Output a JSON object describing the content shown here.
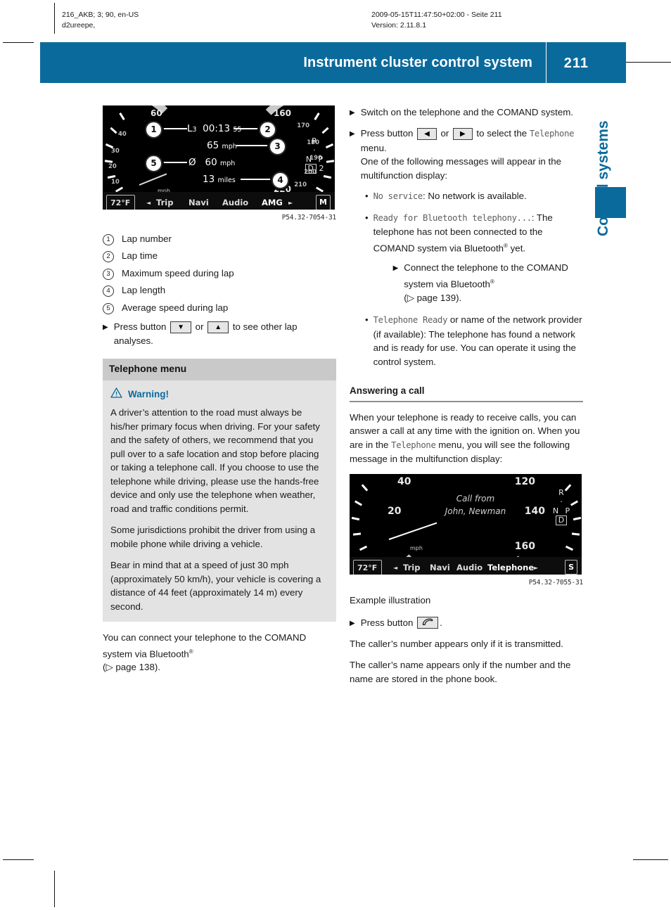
{
  "print_header": {
    "left_line1": "216_AKB; 3; 90, en-US",
    "left_line2": "d2ureepe,",
    "mid_line1": "2009-05-15T11:47:50+02:00 - Seite 211",
    "mid_line2": "Version: 2.11.8.1"
  },
  "banner": {
    "title": "Instrument cluster control system",
    "page_number": "211",
    "color": "#0b6a9c"
  },
  "side_tab": {
    "label": "Control systems"
  },
  "figure_lap": {
    "code": "P54.32-7054-31",
    "readouts": {
      "lap_label": "L",
      "lap_sub": "3",
      "lap_time": "00:13",
      "lap_time_decimals": "55",
      "max_speed": "65",
      "max_speed_unit": "mph",
      "avg_symbol": "Ø",
      "avg_speed": "60",
      "avg_speed_unit": "mph",
      "lap_length": "13",
      "lap_length_unit": "miles"
    },
    "dial_numbers": [
      "60",
      "160",
      "170",
      "180",
      "190",
      "200",
      "210",
      "220",
      "30",
      "20",
      "10",
      "40"
    ],
    "gear": {
      "r": "R",
      "n": "N",
      "p": "P",
      "d": "D",
      "mode": "2"
    },
    "status": {
      "temperature": "72°F",
      "left_arrow": "◄",
      "items": [
        "Trip",
        "Navi",
        "Audio",
        "AMG"
      ],
      "right_arrow": "►",
      "end_label": "M"
    },
    "mph_label": "mph"
  },
  "legend": {
    "items": [
      {
        "num": "1",
        "text": "Lap number"
      },
      {
        "num": "2",
        "text": "Lap time"
      },
      {
        "num": "3",
        "text": "Maximum speed during lap"
      },
      {
        "num": "4",
        "text": "Lap length"
      },
      {
        "num": "5",
        "text": "Average speed during lap"
      }
    ]
  },
  "left_column": {
    "step_lap_analyses": {
      "before": "Press button",
      "key_down": "▼",
      "middle": "or",
      "key_up": "▲",
      "after": "to see other lap analyses."
    },
    "section_heading": "Telephone menu",
    "warning": {
      "title": "Warning!",
      "paragraphs": [
        "A driver’s attention to the road must always be his/her primary focus when driving. For your safety and the safety of others, we recommend that you pull over to a safe location and stop before placing or taking a telephone call. If you choose to use the telephone while driving, please use the hands-free device and only use the telephone when weather, road and traffic conditions permit.",
        "Some jurisdictions prohibit the driver from using a mobile phone while driving a vehicle.",
        "Bear in mind that at a speed of just 30 mph (approximately 50 km/h), your vehicle is covering a distance of 44 feet (approximately 14 m) every second."
      ]
    },
    "closing": {
      "text_before": "You can connect your telephone to the COMAND system via Bluetooth",
      "registered": "®",
      "ref_open": "(",
      "ref_arrow": "▷",
      "ref_page": "page 138",
      "ref_close": ")."
    }
  },
  "right_column": {
    "step_switch_on": {
      "text": "Switch on the telephone and the COMAND system."
    },
    "step_select_menu": {
      "before": "Press button",
      "key_left": "◀",
      "middle": "or",
      "key_right": "▶",
      "after_1": "to select the",
      "menu_name": "Telephone",
      "after_2": "menu.",
      "note": "One of the following messages will appear in the multifunction display:"
    },
    "messages": [
      {
        "display": "No service",
        "text": ": No network is available."
      },
      {
        "display": "Ready for Bluetooth telephony...",
        "text": ": The telephone has not been connected to the COMAND system via Bluetooth",
        "registered": "®",
        "text_tail": " yet.",
        "substep": {
          "text_before": "Connect the telephone to the COMAND system via Bluetooth",
          "registered": "®",
          "ref_open": "(",
          "ref_arrow": "▷",
          "ref_page": "page 139",
          "ref_close": ")."
        }
      },
      {
        "display": "Telephone Ready",
        "text": " or name of the network provider (if available): The telephone has found a network and is ready for use. You can operate it using the control system."
      }
    ],
    "sub_heading": "Answering a call",
    "intro": {
      "part1": "When your telephone is ready to receive calls, you can answer a call at any time with the ignition on. When you are in the",
      "menu_name": "Telephone",
      "part2": "menu, you will see the following message in the multifunction display:"
    },
    "figure_caption": "Example illustration",
    "step_press_phone": {
      "before": "Press button",
      "key_phone": "phone-handset-icon",
      "after": "."
    },
    "closing_paragraphs": [
      "The caller’s number appears only if it is transmitted.",
      "The caller’s name appears only if the number and the name are stored in the phone book."
    ]
  },
  "figure_call": {
    "code": "P54.32-7055-31",
    "call_line1": "Call from",
    "call_line2": "John, Newman",
    "dial_numbers": [
      "40",
      "120",
      "20",
      "140",
      "160"
    ],
    "gear": {
      "r": "R",
      "n": "N",
      "p": "P",
      "d": "D"
    },
    "status": {
      "temperature": "72°F",
      "left_arrow": "◄",
      "items": [
        "Trip",
        "Navi",
        "Audio",
        "Telephone"
      ],
      "right_arrow": "►",
      "end_label": "S"
    },
    "mph_label": "mph"
  }
}
